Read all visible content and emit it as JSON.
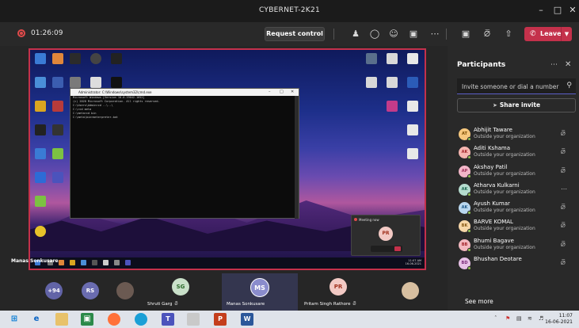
{
  "window": {
    "title": "CYBERNET-2K21"
  },
  "toolbar": {
    "timer": "01:26:09",
    "request_control": "Request control",
    "leave": "Leave"
  },
  "stage": {
    "presenter_name": "Manas Sonkusare",
    "pip_title": "Meeting now",
    "pip_initials": "PR",
    "cmd_title": "Administrator: C:\\Windows\\system32\\cmd.exe",
    "cmd_lines": [
      "Microsoft Windows [Version 10.0.19042.1052]",
      "(c) 2020 Microsoft Corporation. All rights reserved.",
      "",
      "C:\\Users\\Admin>cd ..\\..\\",
      "",
      "C:\\>cd meta",
      "",
      "C:\\meta>cd bin",
      "",
      "C:\\meta\\bin>meterpreter.bat"
    ],
    "inner_time": "11:07 AM",
    "inner_date": "16-06-2021"
  },
  "panel": {
    "title": "Participants",
    "invite_placeholder": "Invite someone or dial a number",
    "share_invite": "Share invite",
    "see_more": "See more",
    "participants": [
      {
        "initials": "AT",
        "name": "Abhijit Taware",
        "sub": "Outside your organization",
        "bg": "#f6c77d",
        "fg": "#7a4b00",
        "status": "mic-off"
      },
      {
        "initials": "AK",
        "name": "Aditi Kshama",
        "sub": "Outside your organization",
        "bg": "#f5b5b0",
        "fg": "#a4262c",
        "status": "mic-off"
      },
      {
        "initials": "AP",
        "name": "Akshay Patil",
        "sub": "Outside your organization",
        "bg": "#f2b6c8",
        "fg": "#a0305a",
        "status": "mic-off"
      },
      {
        "initials": "AK",
        "name": "Atharva Kulkarni",
        "sub": "Outside your organization",
        "bg": "#b5dccf",
        "fg": "#1f6b52",
        "status": "more"
      },
      {
        "initials": "AK",
        "name": "Ayush Kumar",
        "sub": "Outside your organization",
        "bg": "#b9d7ef",
        "fg": "#1e5a8c",
        "status": "mic-off"
      },
      {
        "initials": "BK",
        "name": "BARVE KOMAL",
        "sub": "Outside your organization",
        "bg": "#f7d6a8",
        "fg": "#8a5a16",
        "status": "mic-off"
      },
      {
        "initials": "BB",
        "name": "Bhumi Bagave",
        "sub": "Outside your organization",
        "bg": "#f3b8bf",
        "fg": "#a4262c",
        "status": "mic-off"
      },
      {
        "initials": "BD",
        "name": "Bhushan Deotare",
        "sub": "",
        "bg": "#e7c1e6",
        "fg": "#7c2c7a",
        "status": "mic-off"
      }
    ]
  },
  "gallery": [
    {
      "kind": "count",
      "label": "+94"
    },
    {
      "kind": "avatar",
      "initials": "RS",
      "name": ""
    },
    {
      "kind": "photo",
      "initials": "",
      "name": ""
    },
    {
      "kind": "avatar",
      "initials": "SG",
      "name": "Shruti Garg"
    },
    {
      "kind": "avatar",
      "initials": "MS",
      "name": "Manas Sonkusare"
    },
    {
      "kind": "avatar",
      "initials": "PR",
      "name": "Pritam Singh Rathore"
    },
    {
      "kind": "photo",
      "initials": "",
      "name": ""
    }
  ],
  "taskbar": {
    "time": "11:07",
    "date": "16-06-2021"
  }
}
